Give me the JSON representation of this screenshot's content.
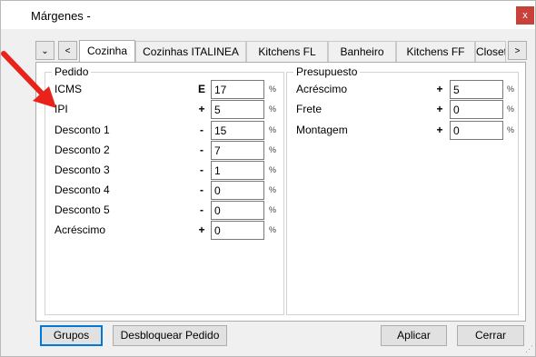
{
  "window": {
    "title": "Márgenes -",
    "close": "x"
  },
  "tabstrip": {
    "scroll_down": "⌄",
    "prev": "<",
    "next": ">",
    "tabs": [
      "Cozinha",
      "Cozinhas ITALINEA",
      "Kitchens FL",
      "Banheiro",
      "Kitchens FF",
      "Closets"
    ],
    "active": "Cozinha"
  },
  "pedido": {
    "legend": "Pedido",
    "rows": [
      {
        "label": "ICMS",
        "sign": "E",
        "value": "17",
        "unit": "%"
      },
      {
        "label": "IPI",
        "sign": "+",
        "value": "5",
        "unit": "%"
      },
      {
        "label": "Desconto 1",
        "sign": "-",
        "value": "15",
        "unit": "%"
      },
      {
        "label": "Desconto 2",
        "sign": "-",
        "value": "7",
        "unit": "%"
      },
      {
        "label": "Desconto 3",
        "sign": "-",
        "value": "1",
        "unit": "%"
      },
      {
        "label": "Desconto 4",
        "sign": "-",
        "value": "0",
        "unit": "%"
      },
      {
        "label": "Desconto 5",
        "sign": "-",
        "value": "0",
        "unit": "%"
      },
      {
        "label": "Acréscimo",
        "sign": "+",
        "value": "0",
        "unit": "%"
      }
    ]
  },
  "presupuesto": {
    "legend": "Presupuesto",
    "rows": [
      {
        "label": "Acréscimo",
        "sign": "+",
        "value": "5",
        "unit": "%"
      },
      {
        "label": "Frete",
        "sign": "+",
        "value": "0",
        "unit": "%"
      },
      {
        "label": "Montagem",
        "sign": "+",
        "value": "0",
        "unit": "%"
      }
    ]
  },
  "buttons": {
    "grupos": "Grupos",
    "desbloquear": "Desbloquear Pedido",
    "aplicar": "Aplicar",
    "cerrar": "Cerrar"
  },
  "colors": {
    "close_bg": "#c8413b",
    "arrow": "#e8231c",
    "focus": "#0078d7"
  }
}
